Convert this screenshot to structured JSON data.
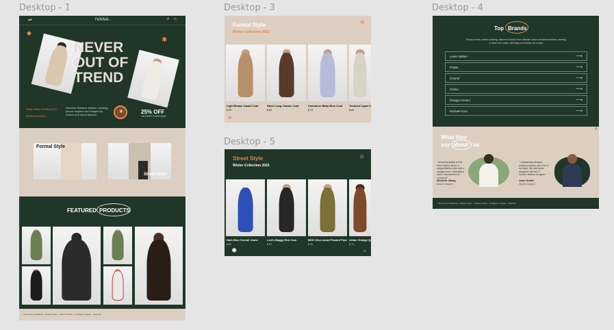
{
  "frames": {
    "d1": "Desktop - 1",
    "d3": "Desktop - 3",
    "d4": "Desktop - 4",
    "d5": "Desktop - 5"
  },
  "d1": {
    "logo": "IVANA.",
    "hero": {
      "line1": "NEVER",
      "line2": "OUT OF",
      "line3": "TREND"
    },
    "nav_featured": "FEATURED PRODUCTS",
    "nav_inspiration": "INSPIRATIONS",
    "hero_desc": "Discover timeless fashion, clothing pieces inspired and shaped by culture and street fashion",
    "discount": "25% OFF",
    "discount_sub": "ON FIRST PURCHASE",
    "formal_label": "Formal Style",
    "street_label": "Street Style",
    "featured_a": "FEATURED",
    "featured_b": "PRODUCTS",
    "footer": "Terms and Conditions · Privacy Policy · Returns Policy · Configure Cookies · Sitemap"
  },
  "d3": {
    "title": "Formal Style",
    "subtitle": "Winter Collection 2023",
    "products": [
      {
        "name": "Light Brown Camel Coat",
        "price": "$ 99"
      },
      {
        "name": "Hazel Long Classic Coat",
        "price": "$ 89"
      },
      {
        "name": "Cashmere Baby Blue Coat",
        "price": "$ 79"
      },
      {
        "name": "Textured Lapel Collar Coat",
        "price": "$ 69"
      }
    ]
  },
  "d5": {
    "title": "Street Style",
    "subtitle": "Winter Collection 2023",
    "products": [
      {
        "name": "Dark Blue Overall Jeans",
        "price": "$ 69"
      },
      {
        "name": "Levi's Baggy Red Jean",
        "price": "$ 59"
      },
      {
        "name": "BDG Olive-wood Pleated Pant",
        "price": "$ 49"
      },
      {
        "name": "Urban Vintage Quilted Jacket",
        "price": "$ 79"
      }
    ]
  },
  "d4": {
    "title_a": "Top",
    "title_b": "Brands",
    "desc": "Product finely crafted clothing, discover brands from ultimate urban and street fashion, starting in store and online with high-end fashion at a value",
    "brands": [
      "Louis Vuitton",
      "Prada",
      "Chanel",
      "Celine",
      "Giorgio Armani",
      "Michael Kors"
    ],
    "about_a": "What they",
    "about_b": "say",
    "about_c": "about",
    "about_d": "us",
    "quote1": "\" Amazing quality on the new Fashion items. A unique fashion vibe with a vintage touch. Definitely a store I recommend for everyone!\"",
    "name1": "Michelle Wang",
    "role1": "Brand Designer",
    "quote2": "\" Outstanding designs, unique products and a lot of fun style. My new jeans designed with the IT modern fashion designer.\"",
    "name2": "John Smith",
    "role2": "Stylist Designer",
    "footer": "Terms and Conditions · Privacy Policy · Returns Policy · Configure Cookies · Sitemap"
  },
  "colors": {
    "green": "#1f3628",
    "beige": "#dccfc1",
    "orange": "#e08a4a"
  }
}
